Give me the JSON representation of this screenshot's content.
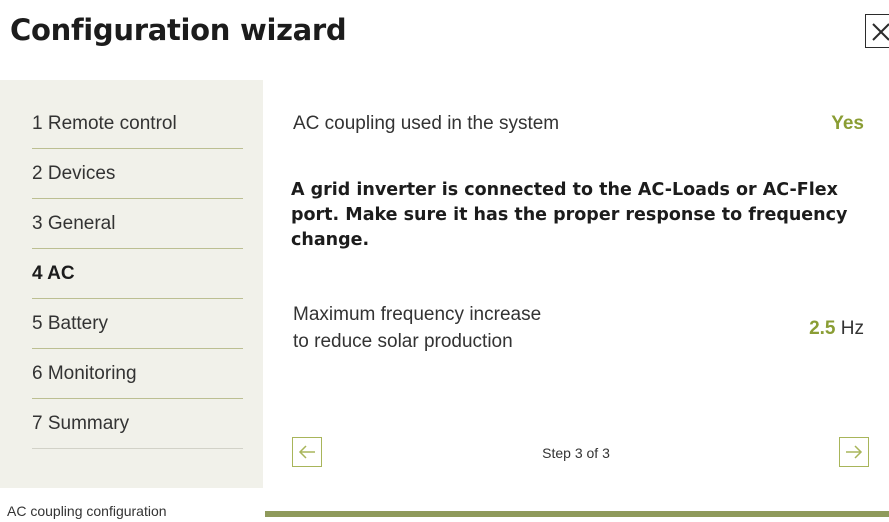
{
  "header": {
    "title": "Configuration wizard"
  },
  "sidebar": {
    "items": [
      {
        "label": "1 Remote control",
        "active": false
      },
      {
        "label": "2 Devices",
        "active": false
      },
      {
        "label": "3 General",
        "active": false
      },
      {
        "label": "4 AC",
        "active": true
      },
      {
        "label": "5 Battery",
        "active": false
      },
      {
        "label": "6 Monitoring",
        "active": false
      },
      {
        "label": "7 Summary",
        "active": false
      }
    ]
  },
  "main": {
    "ac_coupling": {
      "label": "AC coupling used in the system",
      "value": "Yes"
    },
    "notice": "A grid inverter is connected to the AC-Loads or AC-Flex port. Make sure it has the proper response to frequency change.",
    "max_freq": {
      "label_line1": "Maximum frequency increase",
      "label_line2": "to reduce solar production",
      "value": "2.5",
      "unit": "Hz"
    },
    "nav": {
      "prev_icon": "arrow-left-icon",
      "next_icon": "arrow-right-icon",
      "step_text": "Step 3 of 3"
    }
  },
  "footer": {
    "label": "AC coupling configuration",
    "progress": 1.0
  },
  "colors": {
    "accent": "#8a9d34",
    "sidebar_bg": "#f1f1ea",
    "progress": "#8f9a5b",
    "divider": "#bcbf92"
  },
  "icons": {
    "close": "close-icon"
  }
}
